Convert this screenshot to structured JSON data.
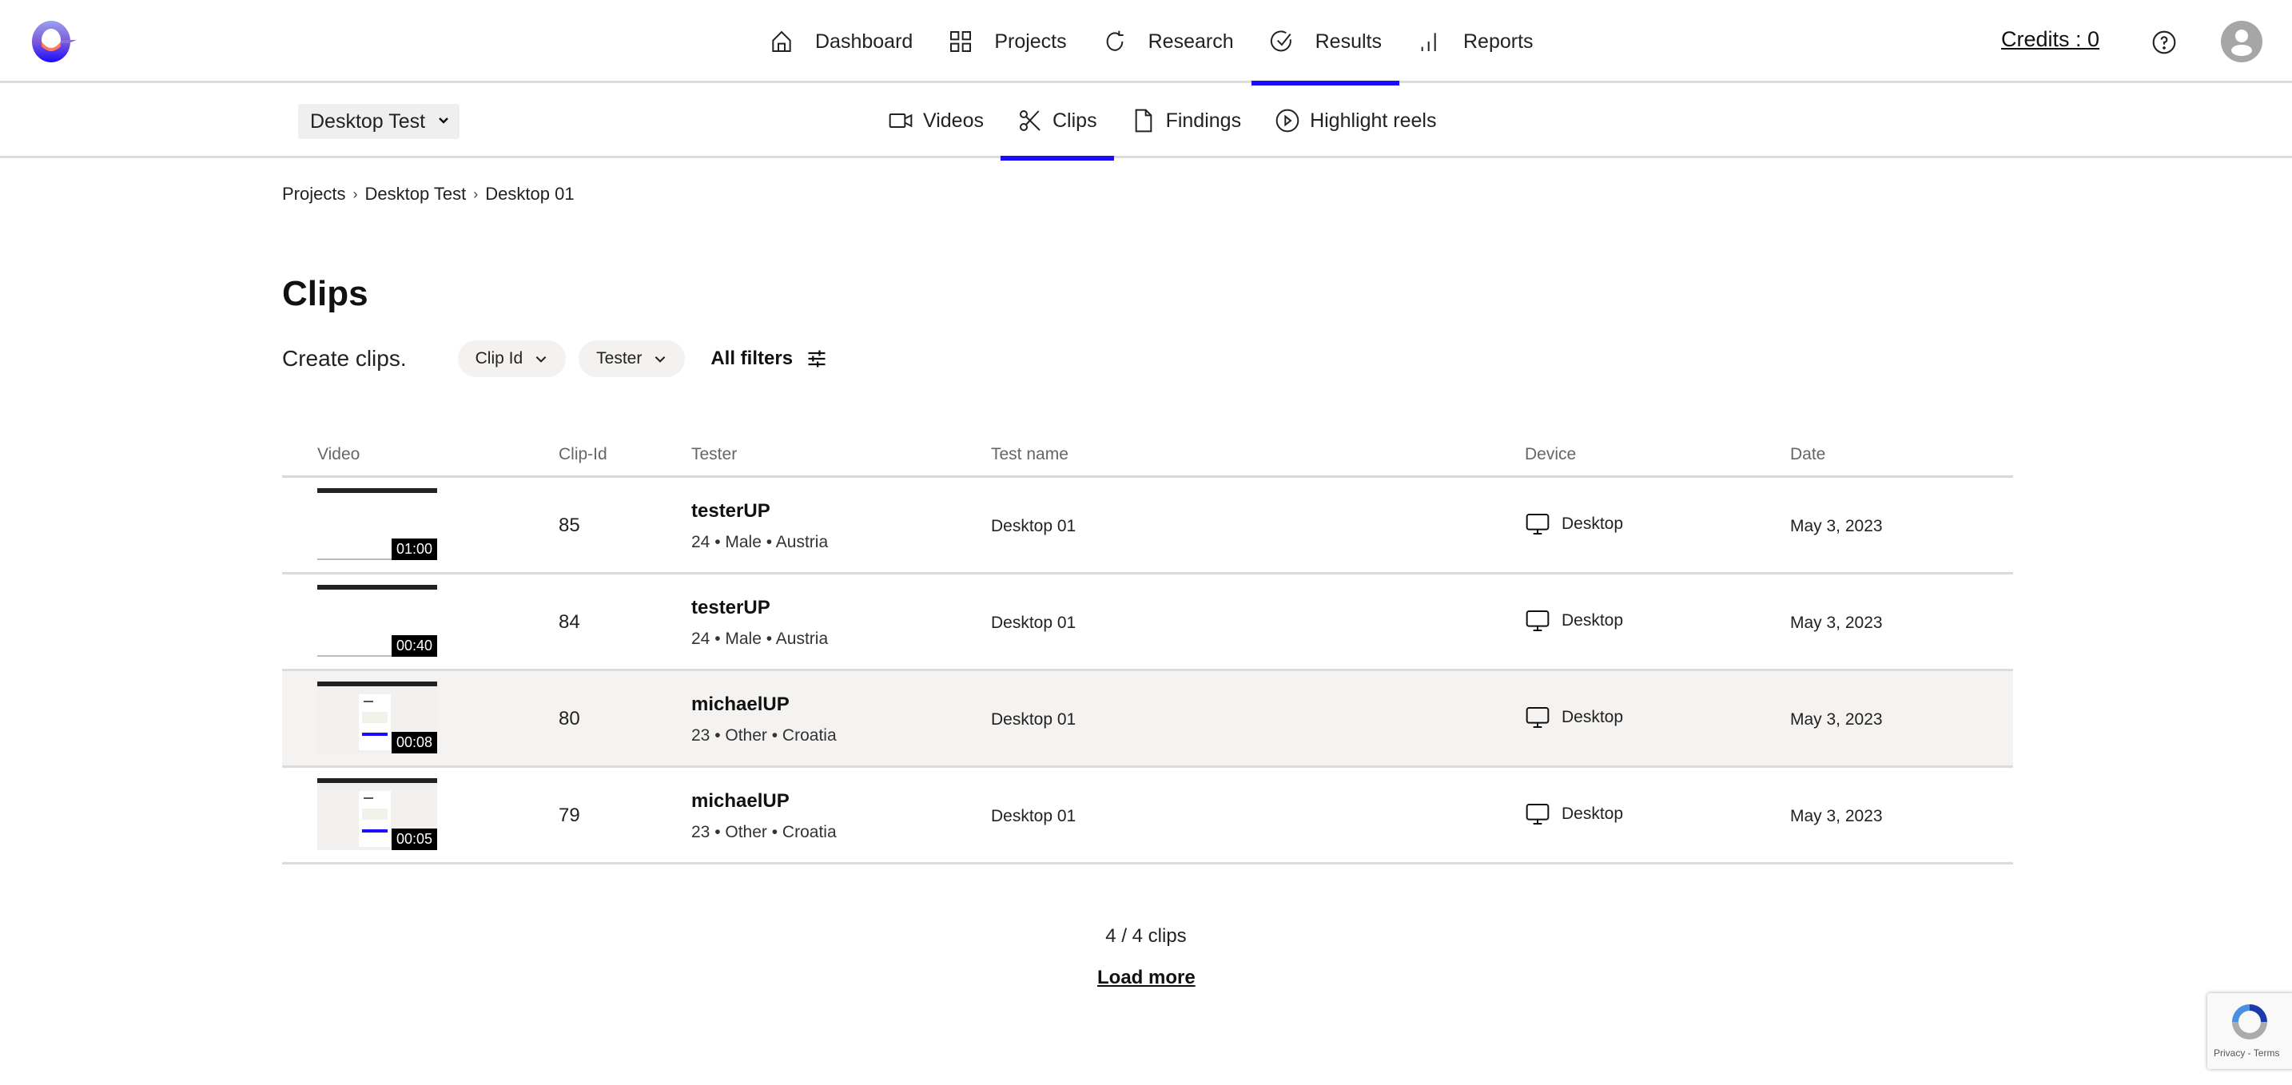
{
  "topnav": {
    "logo": "app-logo",
    "items": [
      {
        "label": "Dashboard",
        "icon": "home-icon",
        "active": false
      },
      {
        "label": "Projects",
        "icon": "grid-icon",
        "active": false
      },
      {
        "label": "Research",
        "icon": "refresh-icon",
        "active": false
      },
      {
        "label": "Results",
        "icon": "check-circle-icon",
        "active": true
      },
      {
        "label": "Reports",
        "icon": "bar-chart-icon",
        "active": false
      }
    ],
    "credits_label": "Credits : 0",
    "help_icon": "help-circle-icon",
    "avatar_icon": "user-avatar-icon"
  },
  "subnav": {
    "project_select": {
      "value": "Desktop Test"
    },
    "tabs": [
      {
        "label": "Videos",
        "icon": "video-icon",
        "active": false
      },
      {
        "label": "Clips",
        "icon": "scissors-icon",
        "active": true
      },
      {
        "label": "Findings",
        "icon": "document-icon",
        "active": false
      },
      {
        "label": "Highlight reels",
        "icon": "play-circle-icon",
        "active": false
      }
    ]
  },
  "breadcrumb": [
    "Projects",
    "Desktop Test",
    "Desktop 01"
  ],
  "page": {
    "title": "Clips",
    "subtitle": "Create clips.",
    "filters": [
      {
        "label": "Clip Id"
      },
      {
        "label": "Tester"
      }
    ],
    "all_filters_label": "All filters"
  },
  "table": {
    "columns": [
      "Video",
      "Clip-Id",
      "Tester",
      "Test name",
      "Device",
      "Date"
    ],
    "rows": [
      {
        "duration": "01:00",
        "clip_id": "85",
        "tester": "testerUP",
        "tester_meta": "24 • Male • Austria",
        "test_name": "Desktop 01",
        "device": "Desktop",
        "date": "May 3, 2023",
        "thumb": "blank"
      },
      {
        "duration": "00:40",
        "clip_id": "84",
        "tester": "testerUP",
        "tester_meta": "24 • Male • Austria",
        "test_name": "Desktop 01",
        "device": "Desktop",
        "date": "May 3, 2023",
        "thumb": "blank"
      },
      {
        "duration": "00:08",
        "clip_id": "80",
        "tester": "michaelUP",
        "tester_meta": "23 • Other • Croatia",
        "test_name": "Desktop 01",
        "device": "Desktop",
        "date": "May 3, 2023",
        "thumb": "screen"
      },
      {
        "duration": "00:05",
        "clip_id": "79",
        "tester": "michaelUP",
        "tester_meta": "23 • Other • Croatia",
        "test_name": "Desktop 01",
        "device": "Desktop",
        "date": "May 3, 2023",
        "thumb": "screen"
      }
    ]
  },
  "footer": {
    "count_label": "4 / 4 clips",
    "load_more_label": "Load more"
  },
  "recaptcha": {
    "label": "Privacy - Terms"
  },
  "colors": {
    "accent": "#1a0dff",
    "hover_row": "#f4f3f1",
    "chip_bg": "#f3f2f0"
  }
}
